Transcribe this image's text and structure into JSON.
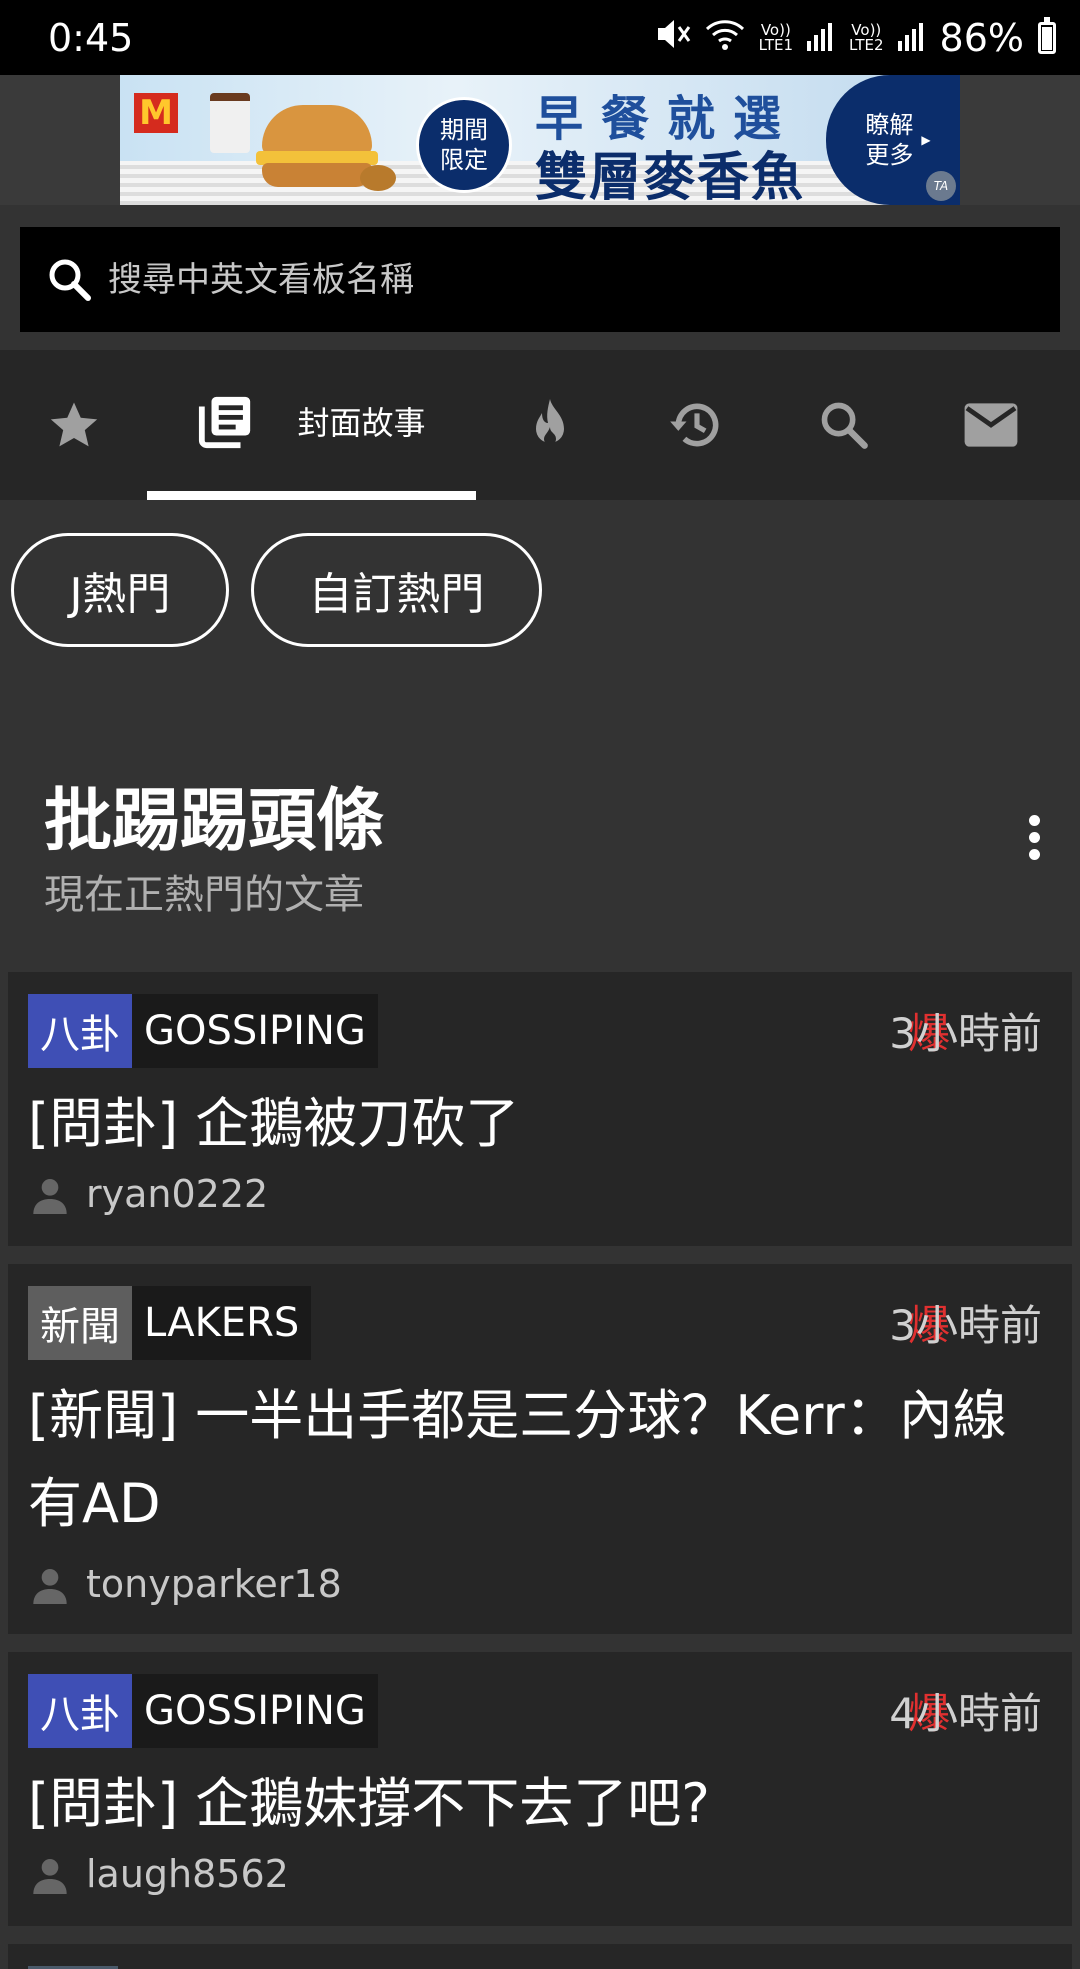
{
  "status_bar": {
    "time": "0:45",
    "sim1": "LTE1",
    "sim2": "LTE2",
    "volte": "Vo))",
    "battery": "86%",
    "battery_level": 0.86
  },
  "ad": {
    "badge_line1": "期間",
    "badge_line2": "限定",
    "headline": "早餐就選",
    "product": "雙層麥香魚",
    "cta_line1": "瞭解",
    "cta_line2": "更多",
    "adchoice": "TA",
    "brand_logo": "M"
  },
  "search": {
    "placeholder": "搜尋中英文看板名稱"
  },
  "tabs": [
    {
      "icon": "star-icon"
    },
    {
      "icon": "cover-story-icon",
      "label": "封面故事",
      "active": true
    },
    {
      "icon": "fire-icon"
    },
    {
      "icon": "history-icon"
    },
    {
      "icon": "search-icon"
    },
    {
      "icon": "mail-icon"
    }
  ],
  "chips": [
    {
      "label": "J熱門"
    },
    {
      "label": "自訂熱門"
    }
  ],
  "section": {
    "title": "批踢踢頭條",
    "subtitle": "現在正熱門的文章"
  },
  "posts": [
    {
      "category": "八卦",
      "category_color": "#3f4fb5",
      "board": "GOSSIPING",
      "hot": "爆",
      "time": "3小時前",
      "title": "[問卦] 企鵝被刀砍了",
      "author": "ryan0222"
    },
    {
      "category": "新聞",
      "category_color": "#5e5e5e",
      "board": "LAKERS",
      "hot": "爆",
      "time": "3小時前",
      "title": "[新聞] 一半出手都是三分球？Kerr：內線有AD",
      "author": "tonyparker18"
    },
    {
      "category": "八卦",
      "category_color": "#3f4fb5",
      "board": "GOSSIPING",
      "hot": "爆",
      "time": "4小時前",
      "title": "[問卦] 企鵝妹撐不下去了吧?",
      "author": "laugh8562"
    }
  ]
}
